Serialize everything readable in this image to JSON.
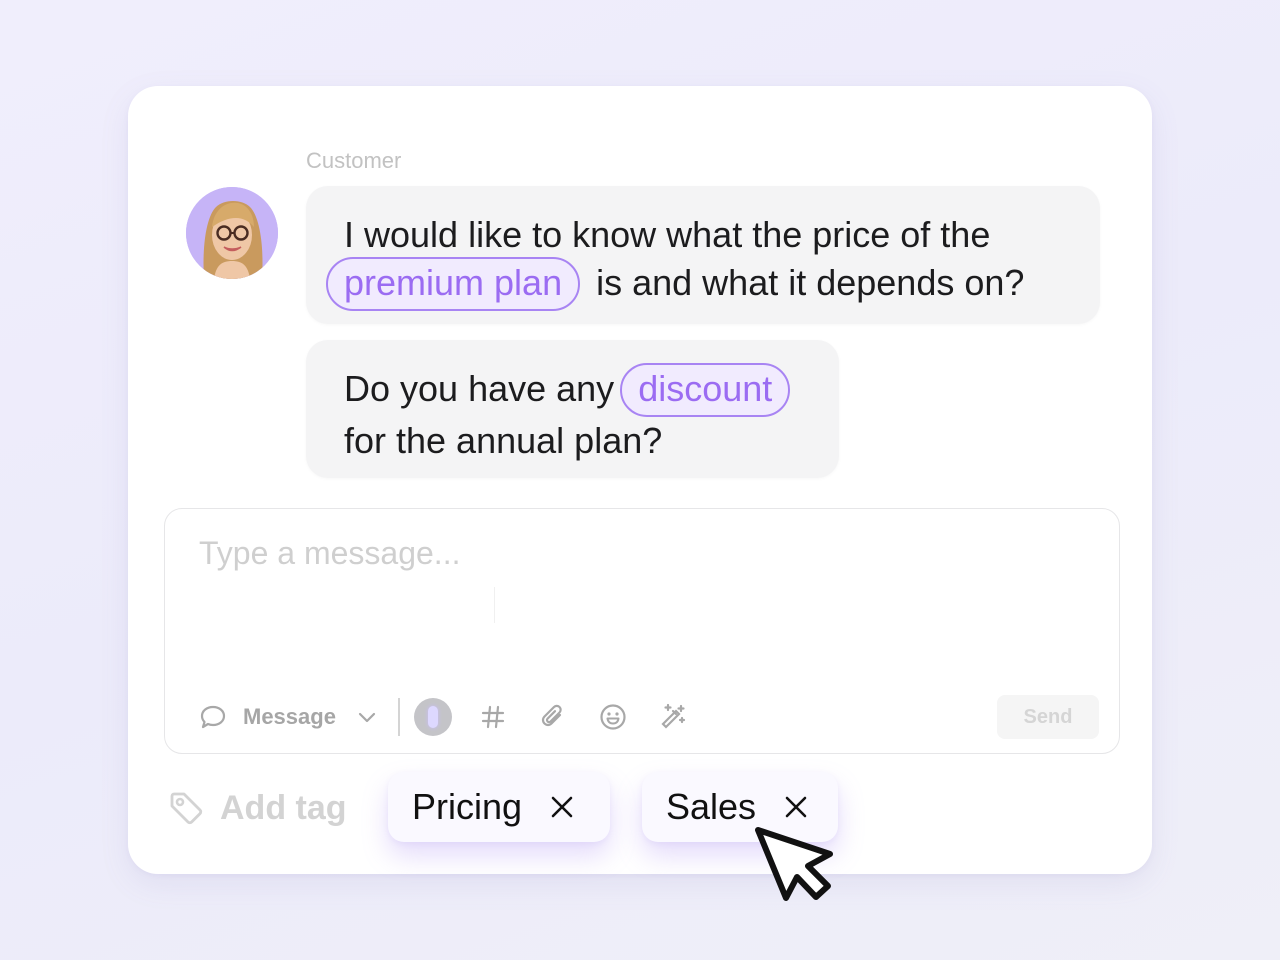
{
  "conversation": {
    "sender_label": "Customer",
    "avatar": "customer-avatar-photo",
    "messages": [
      {
        "text_before": "I would like to know what the price of the",
        "highlight": "premium plan",
        "text_after": "is and what it depends on?"
      },
      {
        "text_before": "Do you have any",
        "highlight": "discount",
        "text_after": "for the annual plan?"
      }
    ]
  },
  "composer": {
    "placeholder": "Type a message...",
    "mode_label": "Message",
    "send_label": "Send",
    "tools": [
      "record-icon",
      "hashtag-icon",
      "paperclip-icon",
      "emoji-icon",
      "magic-wand-icon"
    ]
  },
  "tags": {
    "add_label": "Add tag",
    "items": [
      {
        "label": "Pricing"
      },
      {
        "label": "Sales"
      }
    ]
  },
  "colors": {
    "accent": "#9b6cf2",
    "highlight_bg": "#f1ebfe",
    "bubble_bg": "#f4f4f5",
    "avatar_bg": "#c6b4f7"
  }
}
